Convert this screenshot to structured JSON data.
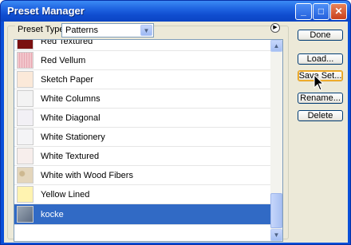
{
  "window": {
    "title": "Preset Manager"
  },
  "titlebar": {
    "minimize_glyph": "_",
    "maximize_glyph": "□",
    "close_glyph": "✕"
  },
  "preset_type": {
    "label": "Preset Type:",
    "selected": "Patterns"
  },
  "list": {
    "items": [
      {
        "label": "Red Textured",
        "color": "#7a1010"
      },
      {
        "label": "Red Vellum",
        "color": "#f2c6cc"
      },
      {
        "label": "Sketch Paper",
        "color": "#fbe9d9"
      },
      {
        "label": "White Columns",
        "color": "#f3f3f3"
      },
      {
        "label": "White Diagonal",
        "color": "#f2f0f5"
      },
      {
        "label": "White Stationery",
        "color": "#f4f4f6"
      },
      {
        "label": "White Textured",
        "color": "#f7eeec"
      },
      {
        "label": "White with Wood Fibers",
        "color": "#e4d6bc"
      },
      {
        "label": "Yellow Lined",
        "color": "#fff3b0"
      },
      {
        "label": "kocke",
        "color": "#7a8aa0",
        "selected": true
      }
    ]
  },
  "buttons": {
    "done": "Done",
    "load": "Load...",
    "save_set": "Save Set...",
    "rename": "Rename...",
    "delete": "Delete"
  },
  "colors": {
    "selection": "#316ac5",
    "titlebar": "#0f4ccf"
  }
}
